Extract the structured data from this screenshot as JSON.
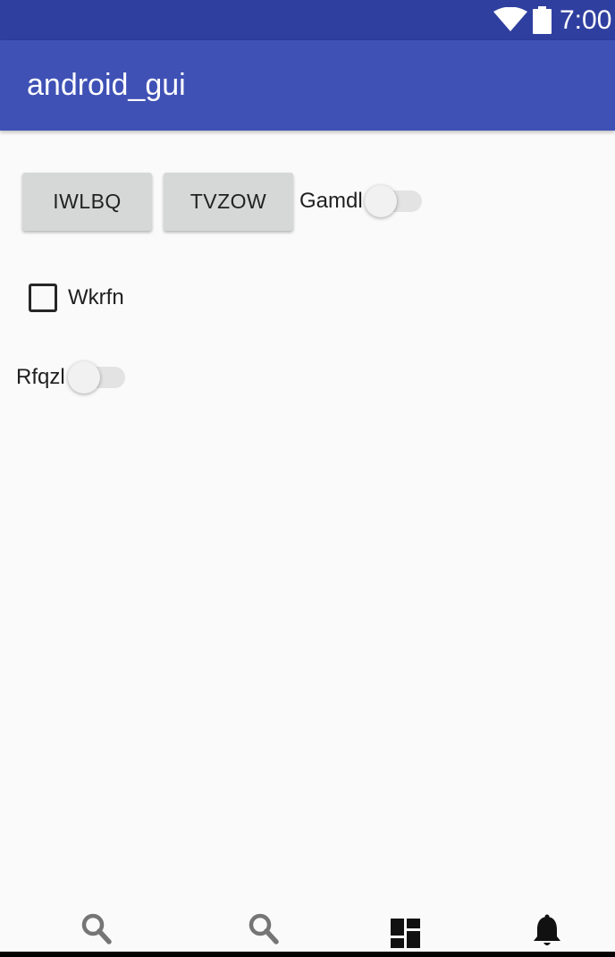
{
  "status_bar": {
    "time": "7:00",
    "icons": [
      "wifi-icon",
      "battery-icon"
    ],
    "background": "#2f3fa0"
  },
  "app_bar": {
    "title": "android_gui",
    "background": "#3f51b5"
  },
  "buttons": [
    {
      "label": "IWLBQ"
    },
    {
      "label": "TVZOW"
    }
  ],
  "switches": [
    {
      "label": "Gamdl",
      "checked": false
    },
    {
      "label": "Rfqzl",
      "checked": false
    }
  ],
  "checkbox": {
    "label": "Wkrfn",
    "checked": false
  },
  "bottom_nav": {
    "items": [
      {
        "icon": "search-icon"
      },
      {
        "icon": "search-icon"
      },
      {
        "icon": "dashboard-icon"
      },
      {
        "icon": "notifications-bell-icon"
      }
    ]
  }
}
